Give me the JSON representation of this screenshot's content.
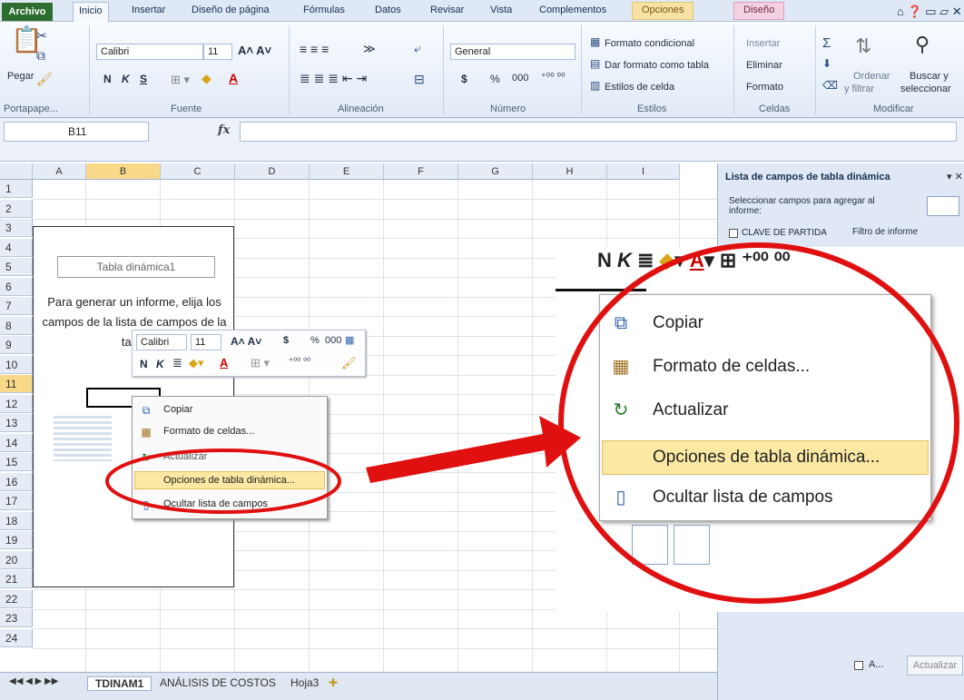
{
  "tabs": {
    "file": "Archivo",
    "active": "Inicio",
    "items": [
      "Insertar",
      "Diseño de página",
      "Fórmulas",
      "Datos",
      "Revisar",
      "Vista",
      "Complementos"
    ],
    "ctx1": "Opciones",
    "ctx2": "Diseño"
  },
  "ribbon": {
    "paste": "Pegar",
    "font_name": "Calibri",
    "font_size": "11",
    "bold": "N",
    "italic": "K",
    "underline": "S",
    "number_format": "General",
    "currency": "$",
    "percent": "%",
    "thousands": "000",
    "cond_format": "Formato condicional",
    "format_table": "Dar formato como tabla",
    "cell_styles": "Estilos de celda",
    "insert": "Insertar",
    "delete": "Eliminar",
    "format": "Formato",
    "sort": "Ordenar",
    "sort2": "y filtrar",
    "find": "Buscar y",
    "find2": "seleccionar",
    "groups": {
      "clipboard": "Portapape...",
      "font": "Fuente",
      "align": "Alineación",
      "number": "Número",
      "styles": "Estilos",
      "cells": "Celdas",
      "modify": "Modificar"
    }
  },
  "formula": {
    "name_box": "B11",
    "fx": "fx",
    "value": ""
  },
  "columns": [
    "A",
    "B",
    "C",
    "D",
    "E",
    "F",
    "G",
    "H",
    "I"
  ],
  "rows": [
    "1",
    "2",
    "3",
    "4",
    "5",
    "6",
    "7",
    "8",
    "9",
    "10",
    "11",
    "12",
    "13",
    "14",
    "15",
    "16",
    "17",
    "18",
    "19",
    "20",
    "21",
    "22",
    "23",
    "24"
  ],
  "pivot": {
    "title": "Tabla dinámica1",
    "text": "Para generar un informe, elija los campos de la lista de campos de la tabla"
  },
  "mini_toolbar": {
    "font": "Calibri",
    "size": "11",
    "currency": "$",
    "percent": "%",
    "thousands": "000",
    "bold": "N",
    "italic": "K"
  },
  "context_menu": {
    "copy": "Copiar",
    "format_cells": "Formato de celdas...",
    "refresh": "Actualizar",
    "pivot_options": "Opciones de tabla dinámica...",
    "hide_list": "Ocultar lista de campos"
  },
  "sheets": {
    "active": "TDINAM1",
    "others": [
      "ANÁLISIS DE COSTOS",
      "Hoja3"
    ]
  },
  "pane": {
    "title": "Lista de campos de tabla dinámica",
    "prompt": "Seleccionar campos para agregar al informe:",
    "field": "CLAVE DE PARTIDA",
    "filter": "Filtro de informe",
    "defer": "A...",
    "update": "Actualizar"
  },
  "colors": {
    "annotation": "#e01010",
    "highlight": "#fbe8a2"
  }
}
